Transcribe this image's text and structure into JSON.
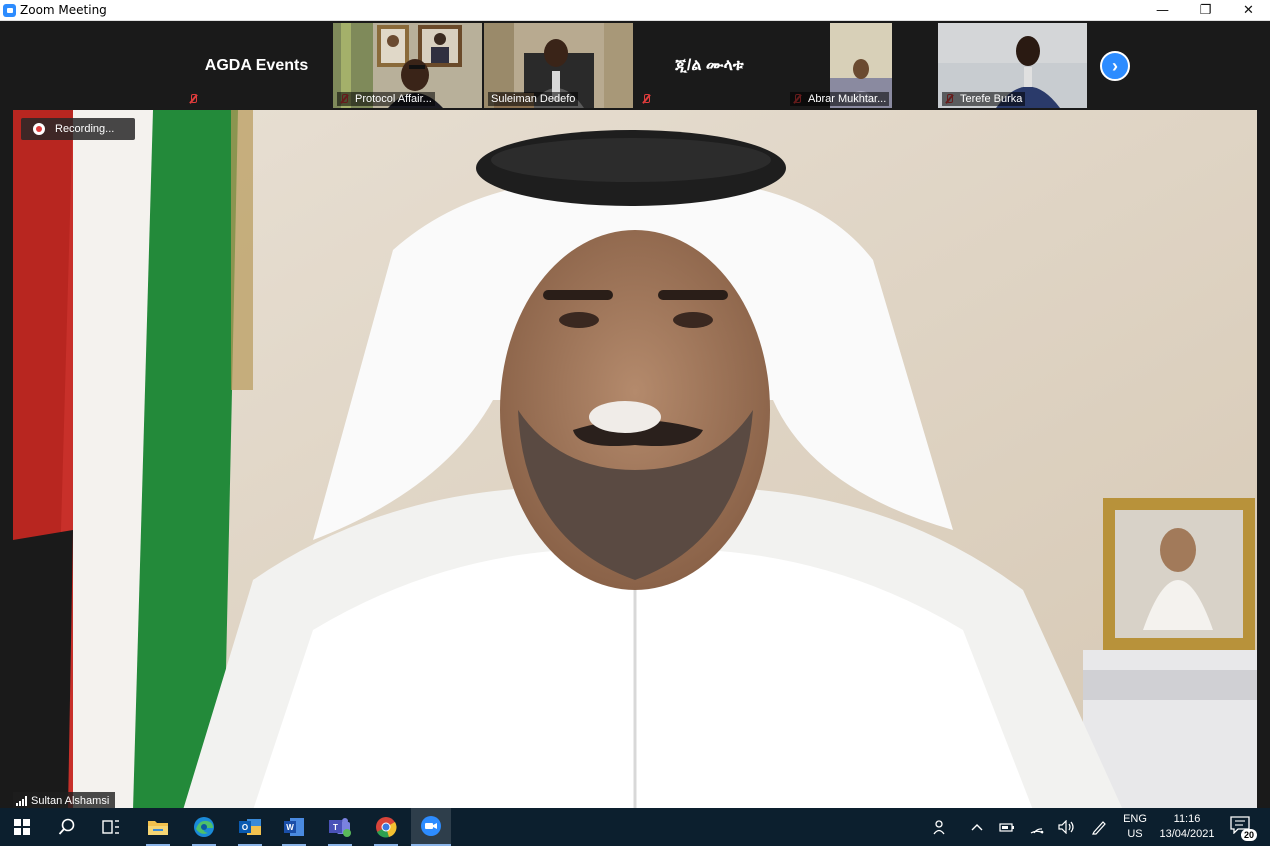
{
  "window": {
    "title": "Zoom Meeting",
    "minimize": "—",
    "restore": "❐",
    "close": "✕"
  },
  "gallery": {
    "tiles": [
      {
        "type": "text",
        "label": "AGDA Events",
        "muted": true
      },
      {
        "type": "video",
        "name": "Protocol Affair...",
        "muted": true
      },
      {
        "type": "video",
        "name": "Suleiman Dedefo",
        "muted": false
      },
      {
        "type": "text",
        "label": "ጂ/ል ሙላቱ",
        "muted": true
      },
      {
        "type": "video",
        "name": "Abrar Mukhtar...",
        "muted": true
      },
      {
        "type": "video",
        "name": "Terefe Burka",
        "muted": true
      }
    ],
    "next_icon": "chevron-right-icon"
  },
  "main": {
    "recording_label": "Recording...",
    "speaker_name": "Sultan Alshamsi"
  },
  "taskbar": {
    "apps": [
      "windows-start-icon",
      "search-icon",
      "task-view-icon",
      "file-explorer-icon",
      "edge-icon",
      "outlook-icon",
      "word-icon",
      "teams-icon",
      "chrome-icon",
      "zoom-icon"
    ],
    "lang_top": "ENG",
    "lang_bottom": "US",
    "time": "11:16",
    "date": "13/04/2021",
    "notification_count": "20"
  },
  "colors": {
    "zoom_blue": "#2d8cff",
    "taskbar_bg": "#0c1f2e",
    "muted_red": "#e03c3c"
  }
}
